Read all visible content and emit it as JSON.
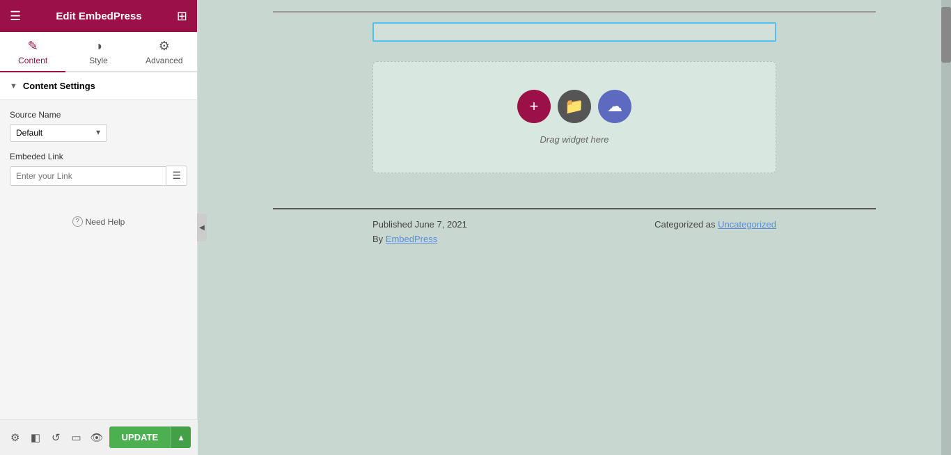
{
  "header": {
    "title": "Edit EmbedPress",
    "hamburger_icon": "☰",
    "grid_icon": "⊞"
  },
  "tabs": [
    {
      "id": "content",
      "label": "Content",
      "icon": "✎",
      "active": true
    },
    {
      "id": "style",
      "label": "Style",
      "icon": "◑",
      "active": false
    },
    {
      "id": "advanced",
      "label": "Advanced",
      "icon": "⚙",
      "active": false
    }
  ],
  "sections": [
    {
      "id": "content-settings",
      "label": "Content Settings",
      "expanded": true
    }
  ],
  "form": {
    "source_name_label": "Source Name",
    "source_name_default": "Default",
    "source_name_options": [
      "Default"
    ],
    "embed_link_label": "Embeded Link",
    "embed_link_placeholder": "Enter your Link"
  },
  "need_help": {
    "label": "Need Help",
    "icon": "?"
  },
  "bottom_bar": {
    "icons": [
      {
        "name": "settings-icon",
        "symbol": "⚙"
      },
      {
        "name": "layers-icon",
        "symbol": "◧"
      },
      {
        "name": "history-icon",
        "symbol": "↺"
      },
      {
        "name": "desktop-icon",
        "symbol": "▭"
      },
      {
        "name": "eye-icon",
        "symbol": "👁"
      }
    ],
    "update_label": "UPDATE",
    "update_arrow": "▲"
  },
  "canvas": {
    "drag_text": "Drag widget here",
    "btn_plus": "+",
    "btn_folder": "📁",
    "btn_cloud": "☁",
    "published_label": "Published June 7, 2021",
    "by_label": "By",
    "by_link": "EmbedPress",
    "categorized_label": "Categorized as",
    "categorized_link": "Uncategorized"
  },
  "colors": {
    "brand": "#9b1046",
    "canvas_bg": "#c8d8d0",
    "update_green": "#4caf50"
  }
}
